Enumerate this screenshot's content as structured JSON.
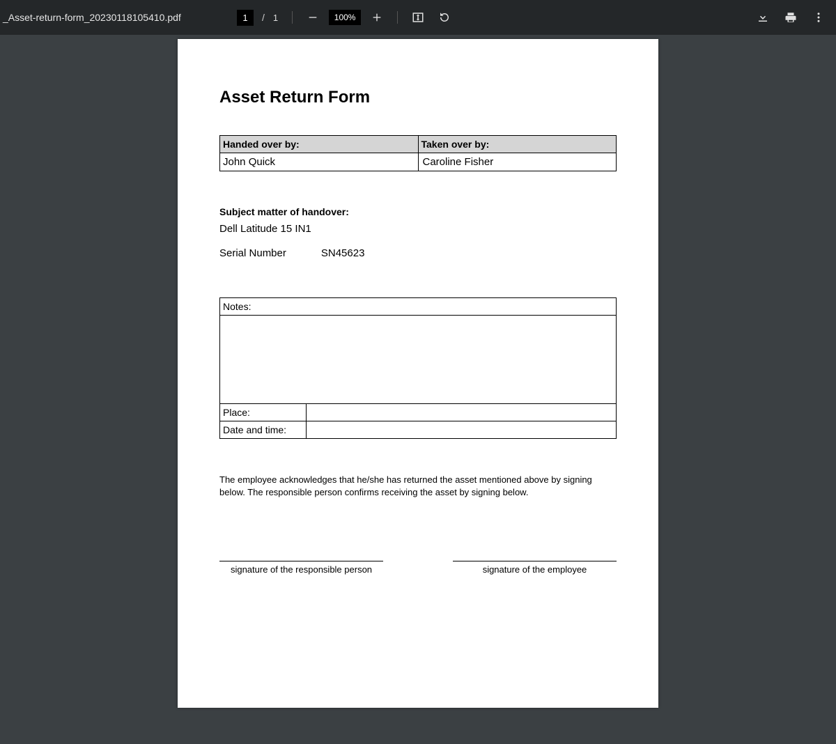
{
  "toolbar": {
    "filename": "_Asset-return-form_20230118105410.pdf",
    "page_current": "1",
    "page_total": "1",
    "zoom": "100%"
  },
  "doc": {
    "title": "Asset Return Form",
    "handed_over_by_label": "Handed over by:",
    "handed_over_by_value": "John Quick",
    "taken_over_by_label": "Taken over by:",
    "taken_over_by_value": "Caroline Fisher",
    "subject_label": "Subject matter of handover:",
    "asset_name": "Dell Latitude 15 IN1",
    "serial_label": "Serial Number",
    "serial_value": "SN45623",
    "notes_label": "Notes:",
    "place_label": "Place:",
    "datetime_label": "Date and time:",
    "ack_text": "The employee acknowledges that he/she has returned the asset mentioned above by signing below. The responsible person confirms receiving the asset by signing below.",
    "sig_responsible": "signature of the responsible person",
    "sig_employee": "signature of the employee"
  }
}
